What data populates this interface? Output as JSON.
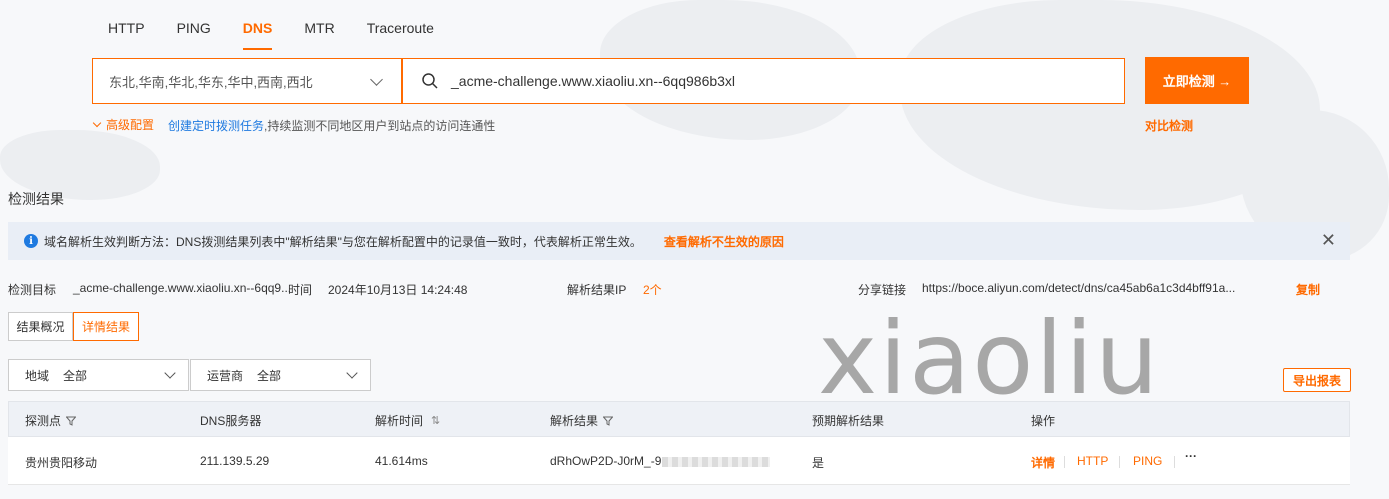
{
  "tabs": [
    "HTTP",
    "PING",
    "DNS",
    "MTR",
    "Traceroute"
  ],
  "active_tab": "DNS",
  "search": {
    "regions": "东北,华南,华北,华东,华中,西南,西北",
    "query": "_acme-challenge.www.xiaoliu.xn--6qq986b3xl",
    "detect_label": "立即检测 →",
    "advanced_label": "高级配置",
    "schedule_link": "创建定时拨测任务",
    "schedule_desc": ",持续监测不同地区用户到站点的访问连通性",
    "compare_label": "对比检测"
  },
  "results": {
    "title": "检测结果",
    "notice_text": "域名解析生效判断方法：DNS拨测结果列表中\"解析结果\"与您在解析配置中的记录值一致时，代表解析正常生效。",
    "notice_link": "查看解析不生效的原因",
    "target_label": "检测目标",
    "target_value": "_acme-challenge.www.xiaoliu.xn--6qq9...",
    "time_label": "时间",
    "time_value": "2024年10月13日 14:24:48",
    "ip_label": "解析结果IP",
    "ip_value": "2个",
    "share_label": "分享链接",
    "share_value": "https://boce.aliyun.com/detect/dns/ca45ab6a1c3d4bff91a...",
    "copy_label": "复制",
    "view_overview": "结果概况",
    "view_detail": "详情结果",
    "filter_region_label": "地域",
    "filter_region_value": "全部",
    "filter_isp_label": "运营商",
    "filter_isp_value": "全部",
    "export_label": "导出报表",
    "watermark": "xiaoliu"
  },
  "table": {
    "headers": [
      "探测点",
      "DNS服务器",
      "解析时间",
      "解析结果",
      "预期解析结果",
      "操作"
    ],
    "rows": [
      {
        "point": "贵州贵阳移动",
        "server": "211.139.5.29",
        "time": "41.614ms",
        "result": "dRhOwP2D-J0rM_-9",
        "expected": "是",
        "actions": [
          "详情",
          "HTTP",
          "PING",
          "···"
        ]
      }
    ]
  },
  "colors": {
    "accent": "#ff6a00",
    "link": "#1f7ae0"
  }
}
